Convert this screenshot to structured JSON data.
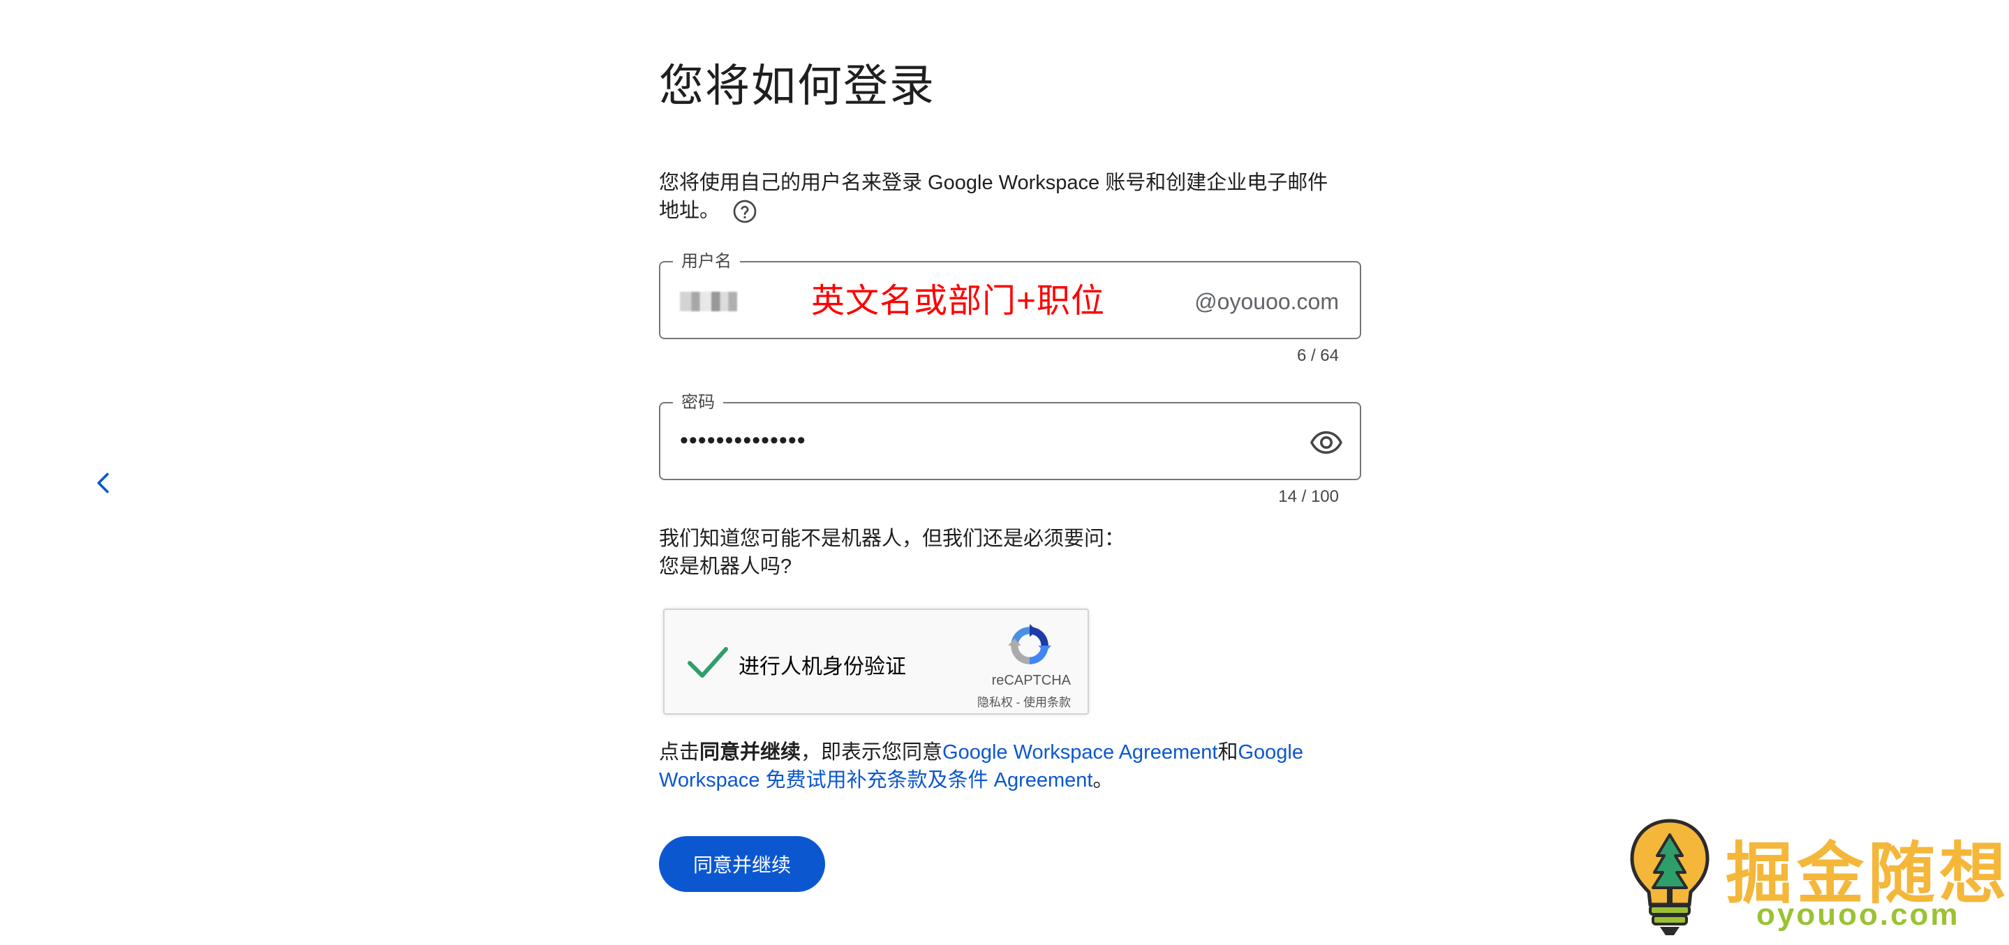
{
  "page": {
    "title": "您将如何登录",
    "description": "您将使用自己的用户名来登录 Google Workspace 账号和创建企业电子邮件地址。"
  },
  "username": {
    "label": "用户名",
    "annotation": "英文名或部门+职位",
    "domain_suffix": "@oyouoo.com",
    "counter": "6 / 64"
  },
  "password": {
    "label": "密码",
    "masked_value": "••••••••••••••",
    "counter": "14 / 100"
  },
  "robot": {
    "line1": "我们知道您可能不是机器人，但我们还是必须要问：",
    "line2": "您是机器人吗?"
  },
  "recaptcha": {
    "label": "进行人机身份验证",
    "brand": "reCAPTCHA",
    "privacy": "隐私权",
    "separator": " - ",
    "terms": "使用条款"
  },
  "terms": {
    "prefix": "点击",
    "bold": "同意并继续",
    "middle": "，即表示您同意",
    "link1": "Google Workspace Agreement",
    "and": "和",
    "link2": "Google Workspace 免费试用补充条款及条件 Agreement",
    "suffix": "。"
  },
  "buttons": {
    "agree": "同意并继续"
  },
  "watermark": {
    "title": "掘金随想",
    "url": "oyouoo.com"
  },
  "colors": {
    "primary": "#0b57d0",
    "annotation": "#ff0000",
    "check": "#2e9e6b",
    "watermark_orange": "#f4b73a",
    "watermark_green": "#9ac234"
  }
}
